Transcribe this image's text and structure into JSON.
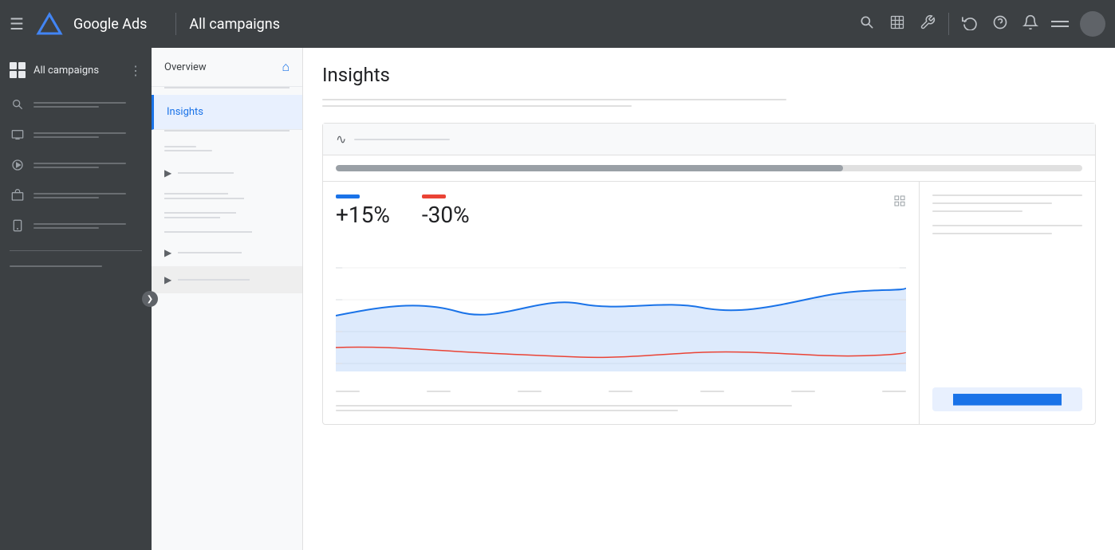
{
  "app": {
    "name": "Google Ads",
    "page_title": "All campaigns"
  },
  "topnav": {
    "menu_icon": "☰",
    "search_icon": "⌕",
    "table_icon": "▦",
    "tools_icon": "⚙",
    "refresh_icon": "↺",
    "help_icon": "?",
    "bell_icon": "🔔"
  },
  "sidebar": {
    "top_label": "All campaigns",
    "items": [
      {
        "id": "search",
        "label_line1": "———",
        "label_line2": "——————"
      },
      {
        "id": "display",
        "label_line1": "———",
        "label_line2": "——————"
      },
      {
        "id": "video",
        "label_line1": "———",
        "label_line2": "——————"
      },
      {
        "id": "shopping",
        "label_line1": "———",
        "label_line2": "——————"
      },
      {
        "id": "app",
        "label_line1": "———",
        "label_line2": "——————"
      }
    ],
    "bottom_label": "——————"
  },
  "middle_nav": {
    "items": [
      {
        "id": "overview",
        "label": "Overview",
        "active": false,
        "has_home": true
      },
      {
        "id": "insights",
        "label": "Insights",
        "active": true,
        "has_home": false
      }
    ],
    "sub_items": [
      {
        "id": "sub1",
        "has_arrow": false
      },
      {
        "id": "sub2",
        "has_arrow": true
      },
      {
        "id": "sub3",
        "has_arrow": false
      },
      {
        "id": "sub4",
        "has_arrow": false
      },
      {
        "id": "sub5",
        "has_arrow": true
      },
      {
        "id": "sub6",
        "has_arrow": true
      }
    ]
  },
  "main": {
    "title": "Insights",
    "subtitle_line1": "————————————————",
    "subtitle_line2": "————————————",
    "chart": {
      "header_text": "∿  ————————————",
      "progress_pct": 68,
      "metric1": {
        "value": "+15%",
        "color": "blue"
      },
      "metric2": {
        "value": "-30%",
        "color": "red"
      },
      "side_lines": [
        "100",
        "80",
        "60"
      ],
      "side_link": "████████████████"
    }
  },
  "colors": {
    "accent_blue": "#1a73e8",
    "accent_red": "#ea4335",
    "nav_bg": "#3c4043",
    "content_bg": "#ffffff",
    "sidebar_bg": "#3c4043",
    "middle_bg": "#f8f9fa",
    "active_bg": "#e8f0fe",
    "chart_blue_fill": "rgba(26,115,232,0.15)",
    "chart_blue_line": "#1a73e8",
    "chart_red_line": "#ea4335"
  }
}
